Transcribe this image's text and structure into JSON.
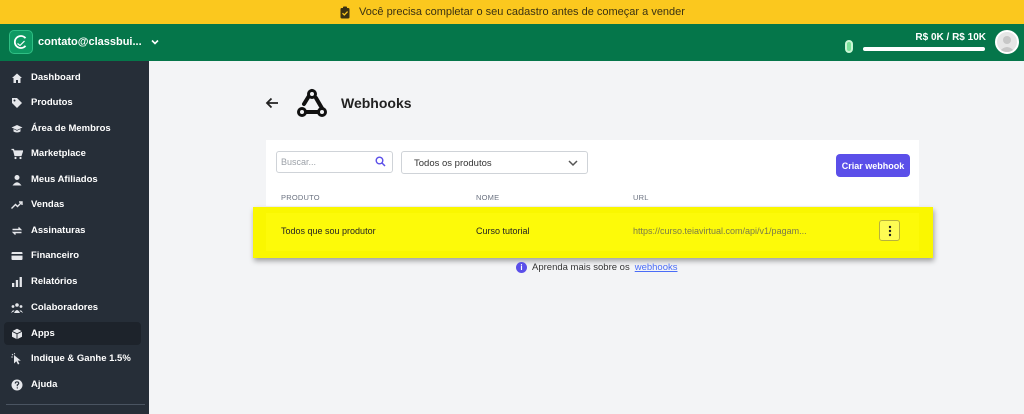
{
  "banner": {
    "text": "Você precisa completar o seu cadastro antes de começar a vender"
  },
  "header": {
    "account": "contato@classbui...",
    "goal": "R$ 0K / R$ 10K",
    "goal_progress": 0.0
  },
  "sidebar": {
    "items": [
      {
        "label": "Dashboard",
        "icon": "home-icon"
      },
      {
        "label": "Produtos",
        "icon": "tag-icon"
      },
      {
        "label": "Área de Membros",
        "icon": "graduation-cap-icon"
      },
      {
        "label": "Marketplace",
        "icon": "cart-icon"
      },
      {
        "label": "Meus Afiliados",
        "icon": "person-icon"
      },
      {
        "label": "Vendas",
        "icon": "trending-icon"
      },
      {
        "label": "Assinaturas",
        "icon": "recurring-icon"
      },
      {
        "label": "Financeiro",
        "icon": "card-icon"
      },
      {
        "label": "Relatórios",
        "icon": "bar-chart-icon"
      },
      {
        "label": "Colaboradores",
        "icon": "people-icon"
      },
      {
        "label": "Apps",
        "icon": "cube-icon",
        "active": true
      },
      {
        "label": "Indique & Ganhe 1.5%",
        "icon": "pointer-icon"
      },
      {
        "label": "Ajuda",
        "icon": "question-icon"
      }
    ]
  },
  "page": {
    "title": "Webhooks"
  },
  "filters": {
    "search_placeholder": "Buscar...",
    "product_select": "Todos os produtos",
    "create_button": "Criar webhook"
  },
  "table": {
    "headers": [
      "PRODUTO",
      "NOME",
      "URL"
    ],
    "rows": [
      {
        "produto": "Todos que sou produtor",
        "nome": "Curso tutorial",
        "url": "https://curso.teiavirtual.com/api/v1/pagam..."
      }
    ]
  },
  "help": {
    "text": "Aprenda mais sobre os",
    "link": "webhooks"
  },
  "colors": {
    "banner": "#fbc81e",
    "header": "#05764a",
    "sidebar": "#262e38",
    "accent": "#5b4fe9",
    "highlight": "#faf700"
  }
}
